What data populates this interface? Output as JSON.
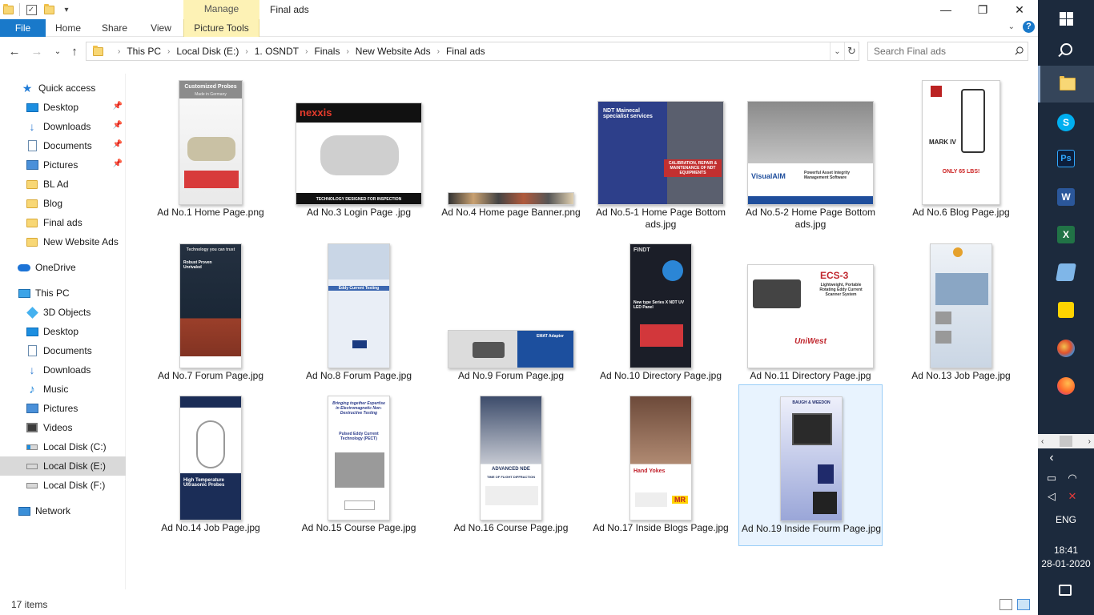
{
  "titlebar": {
    "manage_label": "Manage",
    "window_title": "Final ads",
    "minimize": "—",
    "maximize": "❐",
    "close": "✕"
  },
  "ribbon": {
    "tabs": [
      "File",
      "Home",
      "Share",
      "View"
    ],
    "picture_tools": "Picture Tools",
    "help": "?",
    "collapse": "⌄"
  },
  "address": {
    "back": "←",
    "forward": "→",
    "recent": "⌄",
    "up": "↑",
    "crumbs": [
      "This PC",
      "Local Disk (E:)",
      "1. OSNDT",
      "Finals",
      "New Website Ads",
      "Final ads"
    ],
    "separator": "›",
    "dropdown": "⌄",
    "refresh": "↻",
    "search_placeholder": "Search Final ads"
  },
  "nav": {
    "quick_access": "Quick access",
    "quick_items": [
      {
        "label": "Desktop",
        "icon": "desktop-icon",
        "pinned": true
      },
      {
        "label": "Downloads",
        "icon": "downloads-icon",
        "pinned": true
      },
      {
        "label": "Documents",
        "icon": "documents-icon",
        "pinned": true
      },
      {
        "label": "Pictures",
        "icon": "pictures-icon",
        "pinned": true
      },
      {
        "label": "BL Ad",
        "icon": "folder-icon",
        "pinned": false
      },
      {
        "label": "Blog",
        "icon": "folder-icon",
        "pinned": false
      },
      {
        "label": "Final ads",
        "icon": "folder-icon",
        "pinned": false
      },
      {
        "label": "New Website Ads",
        "icon": "folder-icon",
        "pinned": false
      }
    ],
    "onedrive": "OneDrive",
    "this_pc": "This PC",
    "pc_items": [
      {
        "label": "3D Objects",
        "icon": "3d-objects-icon"
      },
      {
        "label": "Desktop",
        "icon": "desktop-icon"
      },
      {
        "label": "Documents",
        "icon": "documents-icon"
      },
      {
        "label": "Downloads",
        "icon": "downloads-icon"
      },
      {
        "label": "Music",
        "icon": "music-icon"
      },
      {
        "label": "Pictures",
        "icon": "pictures-icon"
      },
      {
        "label": "Videos",
        "icon": "videos-icon"
      },
      {
        "label": "Local Disk (C:)",
        "icon": "drive-c-icon"
      },
      {
        "label": "Local Disk (E:)",
        "icon": "drive-e-icon",
        "selected": true
      },
      {
        "label": "Local Disk (F:)",
        "icon": "drive-f-icon"
      }
    ],
    "network": "Network",
    "pin_glyph": "📌"
  },
  "files": [
    {
      "name": "Ad No.1 Home Page.png",
      "art_text": "Customized Probes",
      "art_sub": "Made in Germany"
    },
    {
      "name": "Ad No.3 Login Page .jpg",
      "art_text": "nexxis",
      "art_sub": "TECHNOLOGY DESIGNED FOR INSPECTION"
    },
    {
      "name": "Ad No.4 Home page Banner.png"
    },
    {
      "name": "Ad No.5-1 Home Page Bottom ads.jpg",
      "art_text": "NDT Mainecal specialist services",
      "art_sub": "CALIBRATION, REPAIR & MAINTENANCE OF NDT EQUIPMENTS"
    },
    {
      "name": "Ad No.5-2 Home Page Bottom ads.jpg",
      "art_text": "VisualAIM",
      "art_sub": "Powerful Asset Integrity Management Software"
    },
    {
      "name": "Ad No.6 Blog Page.jpg",
      "art_text": "MARK IV",
      "art_sub": "ONLY 65 LBS!"
    },
    {
      "name": "Ad No.7 Forum Page.jpg",
      "art_text": "Technology you can trust",
      "art_sub": "Robust Proven Unrivaled"
    },
    {
      "name": "Ad No.8 Forum Page.jpg",
      "art_text": "Eddy Current Testing"
    },
    {
      "name": "Ad No.9 Forum Page.jpg",
      "art_text": "EMAT Adapter"
    },
    {
      "name": "Ad No.10 Directory Page.jpg",
      "art_text": "FINDT",
      "art_sub": "New type Series X NDT UV LED Panel"
    },
    {
      "name": "Ad No.11 Directory Page.jpg",
      "art_text": "ECS-3",
      "art_sub": "Lightweight, Portable Rotating Eddy Current Scanner System",
      "art_brand": "UniWest"
    },
    {
      "name": "Ad No.13 Job Page.jpg"
    },
    {
      "name": "Ad No.14 Job Page.jpg",
      "art_text": "High Temperature Ultrasonic Probes"
    },
    {
      "name": "Ad No.15 Course Page.jpg",
      "art_text": "Bringing together Expertise in Electromagnetic Non-Destructive Testing",
      "art_sub": "Pulsed Eddy Current Technology (PECT)"
    },
    {
      "name": "Ad No.16 Course Page.jpg",
      "art_text": "ADVANCED NDE",
      "art_sub": "TIME OF FLIGHT DIFFRACTION"
    },
    {
      "name": "Ad No.17 Inside Blogs Page.jpg",
      "art_text": "Hand Yokes",
      "art_brand": "MR"
    },
    {
      "name": "Ad No.19 Inside Fourm Page.jpg",
      "art_text": "BAUGH & WEEDON"
    }
  ],
  "status": {
    "items": "17 items"
  },
  "taskbar": {
    "apps": [
      "start-icon",
      "search-icon",
      "file-explorer-icon",
      "skype-icon",
      "photoshop-icon",
      "word-icon",
      "excel-icon",
      "notepad-icon",
      "sticky-notes-icon",
      "paint-icon",
      "firefox-icon"
    ],
    "skype_letter": "S",
    "ps_letter": "Ps",
    "word_letter": "W",
    "excel_letter": "X",
    "language": "ENG",
    "time": "18:41",
    "date": "28-01-2020",
    "scroll_left": "‹",
    "scroll_right": "›",
    "tray_expand": "‹"
  },
  "colors": {
    "accent": "#1979ca",
    "manage_tab": "#fdf2b5",
    "selection": "#e8f3fe",
    "taskbar": "#1c2a3d"
  }
}
